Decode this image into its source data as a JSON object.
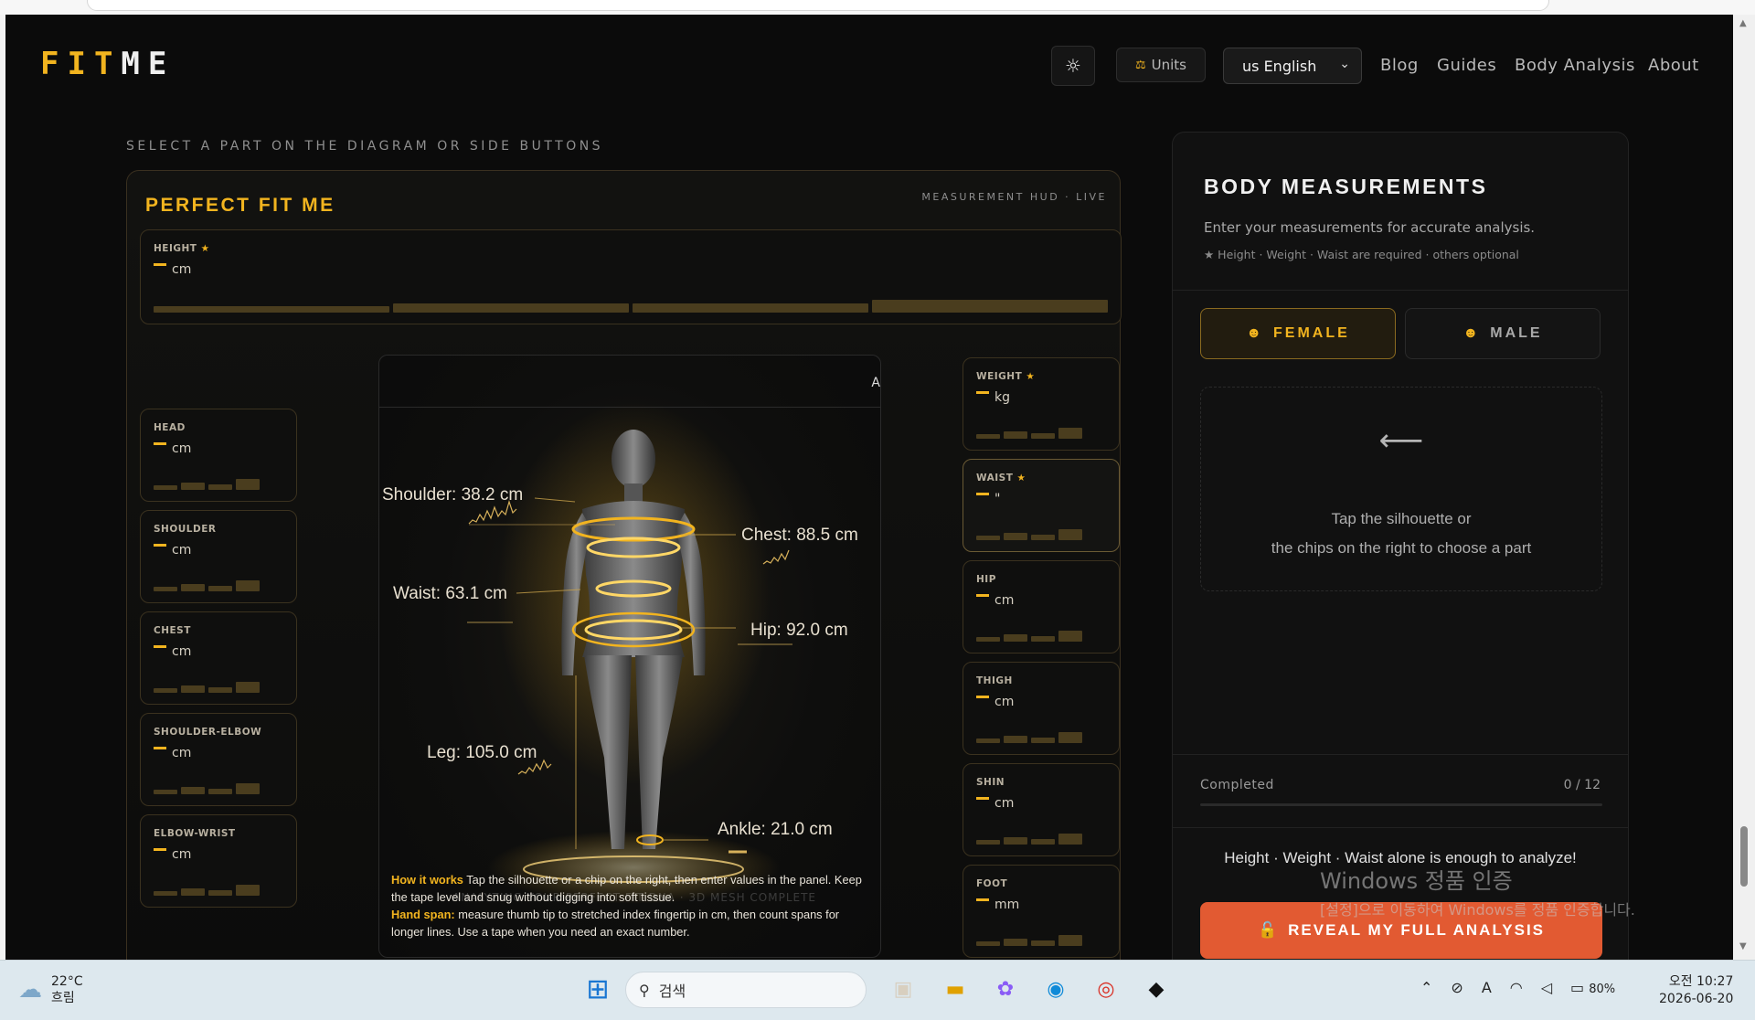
{
  "app": {
    "logo_part1": "FIT",
    "logo_part2": "ME",
    "nav": {
      "units_label": "Units",
      "language": "us English",
      "links": [
        "Blog",
        "Guides",
        "Body Analysis",
        "About"
      ]
    }
  },
  "hud": {
    "select_hint": "SELECT A PART ON THE DIAGRAM OR SIDE BUTTONS",
    "title": "PERFECT FIT ME",
    "status": "MEASUREMENT HUD · LIVE",
    "height_chip": {
      "label": "HEIGHT",
      "required": true,
      "value": "",
      "unit": "cm"
    },
    "left_chips": [
      {
        "label": "HEAD",
        "unit": "cm"
      },
      {
        "label": "SHOULDER",
        "unit": "cm"
      },
      {
        "label": "CHEST",
        "unit": "cm"
      },
      {
        "label": "SHOULDER-ELBOW",
        "unit": "cm"
      },
      {
        "label": "ELBOW-WRIST",
        "unit": "cm"
      }
    ],
    "right_chips": [
      {
        "label": "WEIGHT",
        "required": true,
        "unit": "kg"
      },
      {
        "label": "WAIST",
        "required": true,
        "unit": "\""
      },
      {
        "label": "HIP",
        "unit": "cm"
      },
      {
        "label": "THIGH",
        "unit": "cm"
      },
      {
        "label": "SHIN",
        "unit": "cm"
      },
      {
        "label": "FOOT",
        "unit": "mm"
      }
    ],
    "figure_corner": "A",
    "figure_labels": {
      "shoulder": "Shoulder: 38.2 cm",
      "chest": "Chest: 88.5 cm",
      "waist": "Waist: 63.1 cm",
      "hip": "Hip: 92.0 cm",
      "leg": "Leg: 105.0 cm",
      "ankle": "Ankle: 21.0 cm"
    },
    "howto": {
      "how_title": "How it works",
      "how_text": " Tap the silhouette or a chip on the right, then enter values in the panel. Keep the tape level and snug without digging into soft tissue.",
      "span_title": "Hand span:",
      "span_text": " measure thumb tip to stretched index fingertip in cm, then count spans for longer lines. Use a tape when you need an exact number.",
      "overlay_text": "ANALYZING YOUR PERFECT FIT DNA · 3D MESH COMPLETE"
    }
  },
  "side": {
    "title": "BODY MEASUREMENTS",
    "subtitle": "Enter your measurements for accurate analysis.",
    "required_note": "★ Height · Weight · Waist are required · others optional",
    "female_label": "FEMALE",
    "male_label": "MALE",
    "selected_gender": "female",
    "pick_line1": "Tap the silhouette or",
    "pick_line2": "the chips on the right to choose a part",
    "completed_label": "Completed",
    "completed_value": "0 / 12",
    "completed_fraction": 0,
    "enough_text": "Height · Weight · Waist alone is enough to analyze!",
    "reveal_label": "REVEAL MY FULL ANALYSIS"
  },
  "os": {
    "watermark_title": "Windows 정품 인증",
    "watermark_sub": "[설정]으로 이동하여 Windows를 정품 인증합니다.",
    "weather_temp": "22°C",
    "weather_desc": "흐림",
    "search_placeholder": "검색",
    "battery": "80%",
    "time": "오전 10:27",
    "date": "2026-06-20"
  },
  "colors": {
    "accent": "#f2b41f",
    "cta": "#e25a32",
    "background": "#0b0b0b"
  }
}
